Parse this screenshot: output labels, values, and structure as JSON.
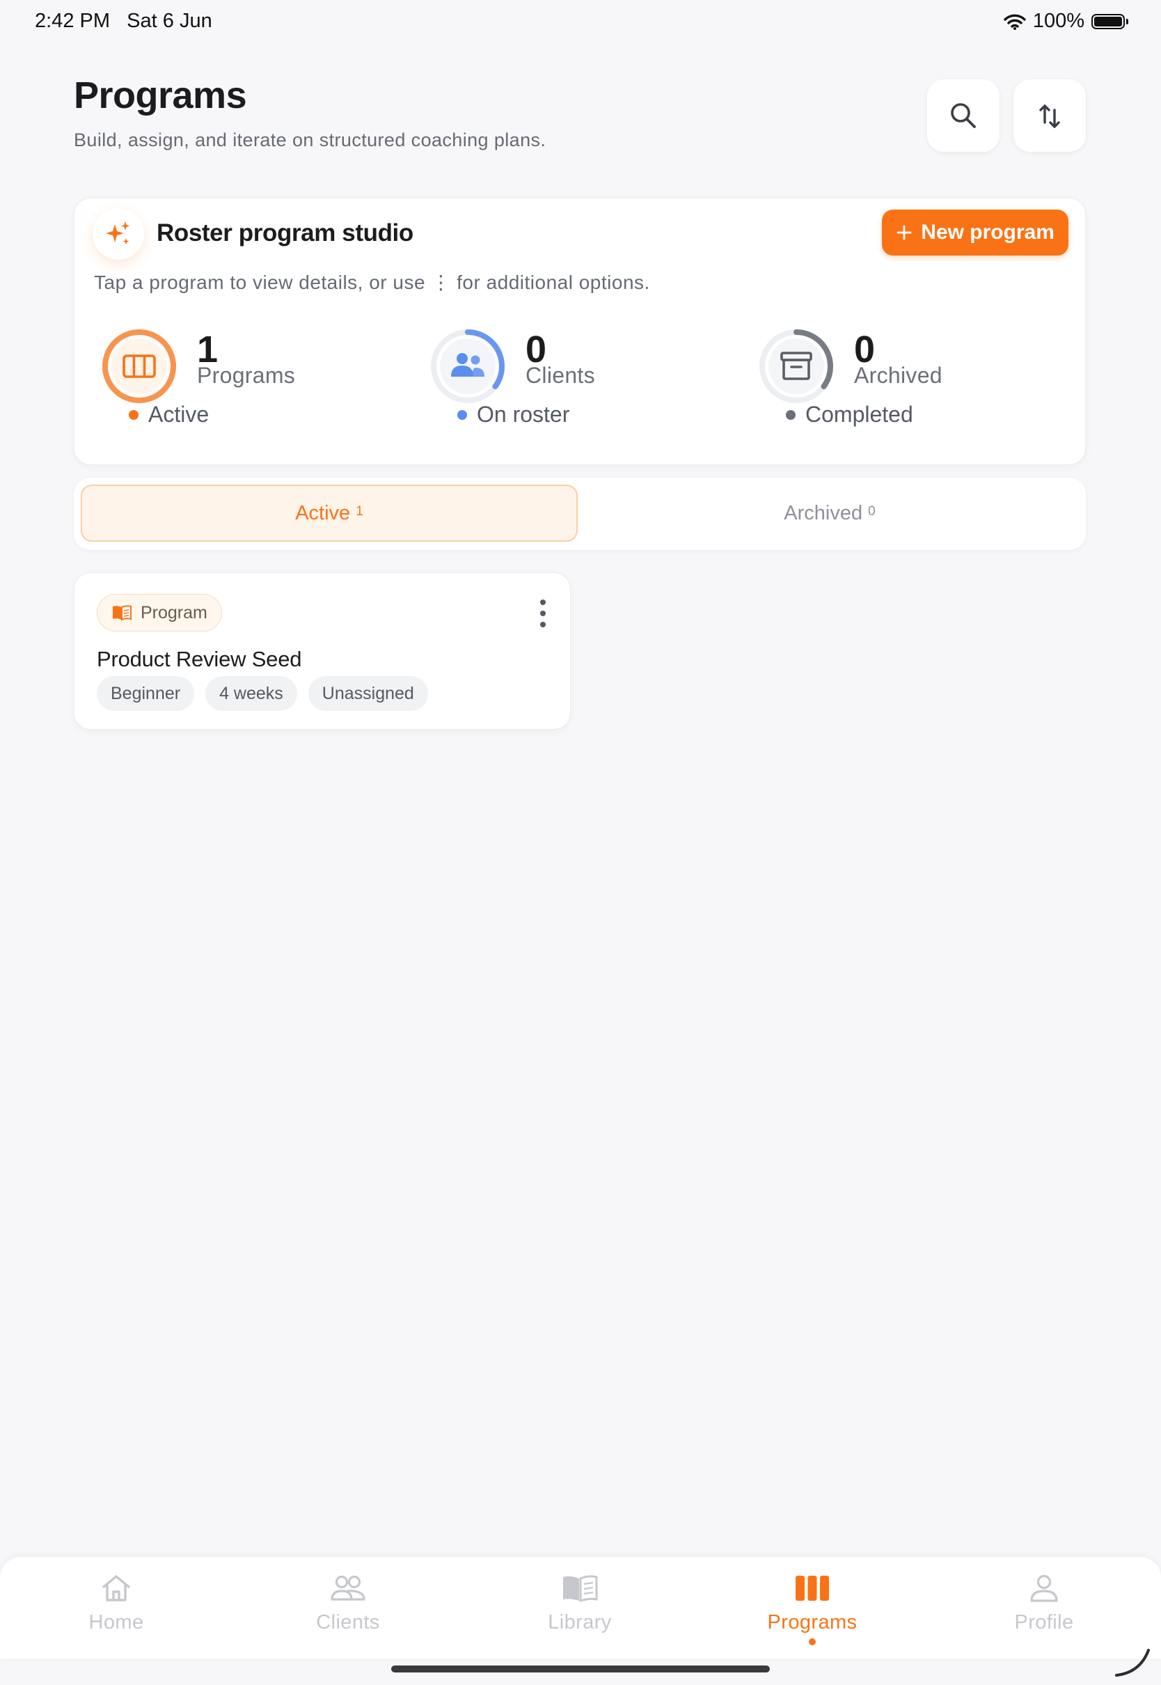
{
  "status_bar": {
    "time": "2:42 PM",
    "date": "Sat 6 Jun",
    "battery": "100%"
  },
  "header": {
    "title": "Programs",
    "subtitle": "Build, assign, and iterate on structured coaching plans.",
    "search_icon": "search-icon",
    "sort_icon": "sort-icon"
  },
  "studio": {
    "title": "Roster program studio",
    "new_button": "New program",
    "hint": "Tap a program to view details, or use ⋮ for additional options.",
    "stats": [
      {
        "number": "1",
        "label": "Programs",
        "foot": "Active",
        "color": "#f97316",
        "progress": 1.0,
        "icon": "columns-icon"
      },
      {
        "number": "0",
        "label": "Clients",
        "foot": "On roster",
        "color": "#5b8def",
        "progress": 0.35,
        "icon": "users-icon"
      },
      {
        "number": "0",
        "label": "Archived",
        "foot": "Completed",
        "color": "#6b6f78",
        "progress": 0.35,
        "icon": "archive-icon"
      }
    ]
  },
  "segments": {
    "active": {
      "label": "Active",
      "count": "1"
    },
    "archived": {
      "label": "Archived",
      "count": "0"
    }
  },
  "program_card": {
    "badge": "Program",
    "title": "Product Review Seed",
    "chips": [
      "Beginner",
      "4 weeks",
      "Unassigned"
    ]
  },
  "tabbar": {
    "items": [
      {
        "label": "Home",
        "icon": "home-icon"
      },
      {
        "label": "Clients",
        "icon": "users-icon"
      },
      {
        "label": "Library",
        "icon": "book-icon"
      },
      {
        "label": "Programs",
        "icon": "columns-icon",
        "active": true
      },
      {
        "label": "Profile",
        "icon": "profile-icon"
      }
    ]
  },
  "colors": {
    "accent": "#f97316",
    "blue": "#5b8def",
    "muted": "#8d9199"
  }
}
